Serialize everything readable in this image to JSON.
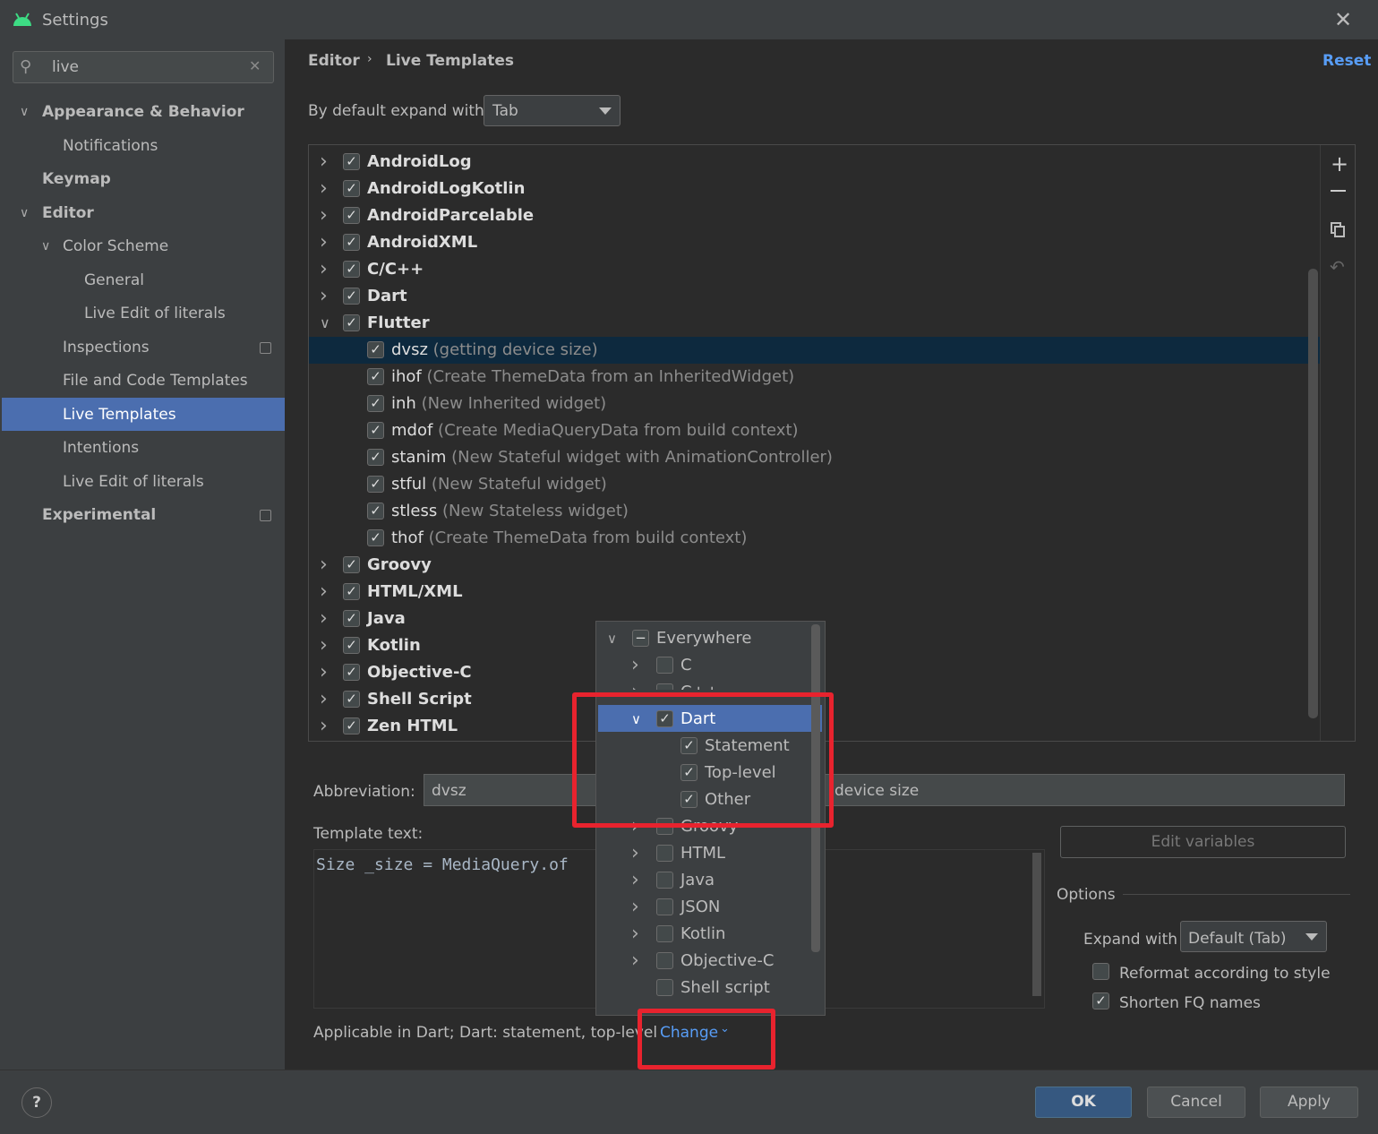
{
  "window": {
    "title": "Settings",
    "close_icon": "close-icon"
  },
  "search": {
    "value": "live",
    "placeholder": "",
    "icon": "search-icon"
  },
  "sidebar": {
    "items": [
      {
        "label": "Appearance & Behavior",
        "level": 0,
        "bold": true,
        "expanded": true
      },
      {
        "label": "Notifications",
        "level": 1
      },
      {
        "label": "Keymap",
        "level": 0,
        "bold": true
      },
      {
        "label": "Editor",
        "level": 0,
        "bold": true,
        "expanded": true
      },
      {
        "label": "Color Scheme",
        "level": 1,
        "expanded": true
      },
      {
        "label": "General",
        "level": 2
      },
      {
        "label": "Live Edit of literals",
        "level": 2
      },
      {
        "label": "Inspections",
        "level": 1,
        "badge": true
      },
      {
        "label": "File and Code Templates",
        "level": 1
      },
      {
        "label": "Live Templates",
        "level": 1,
        "selected": true
      },
      {
        "label": "Intentions",
        "level": 1
      },
      {
        "label": "Live Edit of literals",
        "level": 1
      },
      {
        "label": "Experimental",
        "level": 0,
        "bold": true,
        "badge": true
      }
    ]
  },
  "header": {
    "breadcrumb": [
      "Editor",
      "Live Templates"
    ],
    "separator": "›",
    "reset_label": "Reset"
  },
  "expand_default": {
    "label": "By default expand with",
    "value": "Tab"
  },
  "templates": {
    "groups_before": [
      {
        "name": "AndroidLog",
        "checked": true
      },
      {
        "name": "AndroidLogKotlin",
        "checked": true
      },
      {
        "name": "AndroidParcelable",
        "checked": true
      },
      {
        "name": "AndroidXML",
        "checked": true
      },
      {
        "name": "C/C++",
        "checked": true
      },
      {
        "name": "Dart",
        "checked": true
      }
    ],
    "expanded_group": {
      "name": "Flutter",
      "checked": true
    },
    "flutter_items": [
      {
        "abbr": "dvsz",
        "desc": "(getting device size)",
        "checked": true,
        "selected": true
      },
      {
        "abbr": "ihof",
        "desc": "(Create ThemeData from an InheritedWidget)",
        "checked": true
      },
      {
        "abbr": "inh",
        "desc": "(New Inherited widget)",
        "checked": true
      },
      {
        "abbr": "mdof",
        "desc": "(Create MediaQueryData from build context)",
        "checked": true
      },
      {
        "abbr": "stanim",
        "desc": "(New Stateful widget with AnimationController)",
        "checked": true
      },
      {
        "abbr": "stful",
        "desc": "(New Stateful widget)",
        "checked": true
      },
      {
        "abbr": "stless",
        "desc": "(New Stateless widget)",
        "checked": true
      },
      {
        "abbr": "thof",
        "desc": "(Create ThemeData from build context)",
        "checked": true
      }
    ],
    "groups_after": [
      {
        "name": "Groovy",
        "checked": true
      },
      {
        "name": "HTML/XML",
        "checked": true
      },
      {
        "name": "Java",
        "checked": true
      },
      {
        "name": "Kotlin",
        "checked": true
      },
      {
        "name": "Objective-C",
        "checked": true
      },
      {
        "name": "Shell Script",
        "checked": true
      },
      {
        "name": "Zen HTML",
        "checked": true
      }
    ],
    "toolbar_icons": [
      "add-icon",
      "remove-icon",
      "copy-icon",
      "restore-icon"
    ]
  },
  "detail": {
    "abbreviation_label": "Abbreviation:",
    "abbreviation_value": "dvsz",
    "description_value": "device size",
    "template_text_label": "Template text:",
    "template_text_value": "Size _size = MediaQuery.of",
    "edit_variables_label": "Edit variables",
    "options_title": "Options",
    "expand_with_label": "Expand with",
    "expand_with_value": "Default (Tab)",
    "reformat_label": "Reformat according to style",
    "reformat_checked": false,
    "shorten_label": "Shorten FQ names",
    "shorten_checked": true,
    "applicable_text": "Applicable in Dart; Dart: statement, top-level",
    "change_label": "Change"
  },
  "context_popup": {
    "rows": [
      {
        "label": "Everywhere",
        "level": 0,
        "chevron": "down",
        "state": "partial"
      },
      {
        "label": "C",
        "level": 1,
        "chevron": "right",
        "state": "unchecked"
      },
      {
        "label": "C++",
        "level": 1,
        "chevron": "right",
        "state": "unchecked",
        "clipped": true
      },
      {
        "label": "Dart",
        "level": 1,
        "chevron": "down",
        "state": "checked",
        "selected": true
      },
      {
        "label": "Statement",
        "level": 2,
        "state": "checked"
      },
      {
        "label": "Top-level",
        "level": 2,
        "state": "checked"
      },
      {
        "label": "Other",
        "level": 2,
        "state": "checked"
      },
      {
        "label": "Groovy",
        "level": 1,
        "chevron": "right",
        "state": "unchecked"
      },
      {
        "label": "HTML",
        "level": 1,
        "chevron": "right",
        "state": "unchecked"
      },
      {
        "label": "Java",
        "level": 1,
        "chevron": "right",
        "state": "unchecked"
      },
      {
        "label": "JSON",
        "level": 1,
        "chevron": "right",
        "state": "unchecked"
      },
      {
        "label": "Kotlin",
        "level": 1,
        "chevron": "right",
        "state": "unchecked"
      },
      {
        "label": "Objective-C",
        "level": 1,
        "chevron": "right",
        "state": "unchecked"
      },
      {
        "label": "Shell script",
        "level": 1,
        "state": "unchecked"
      }
    ]
  },
  "annotation_color": "#e8232e",
  "footer": {
    "help_label": "?",
    "ok_label": "OK",
    "cancel_label": "Cancel",
    "apply_label": "Apply"
  }
}
